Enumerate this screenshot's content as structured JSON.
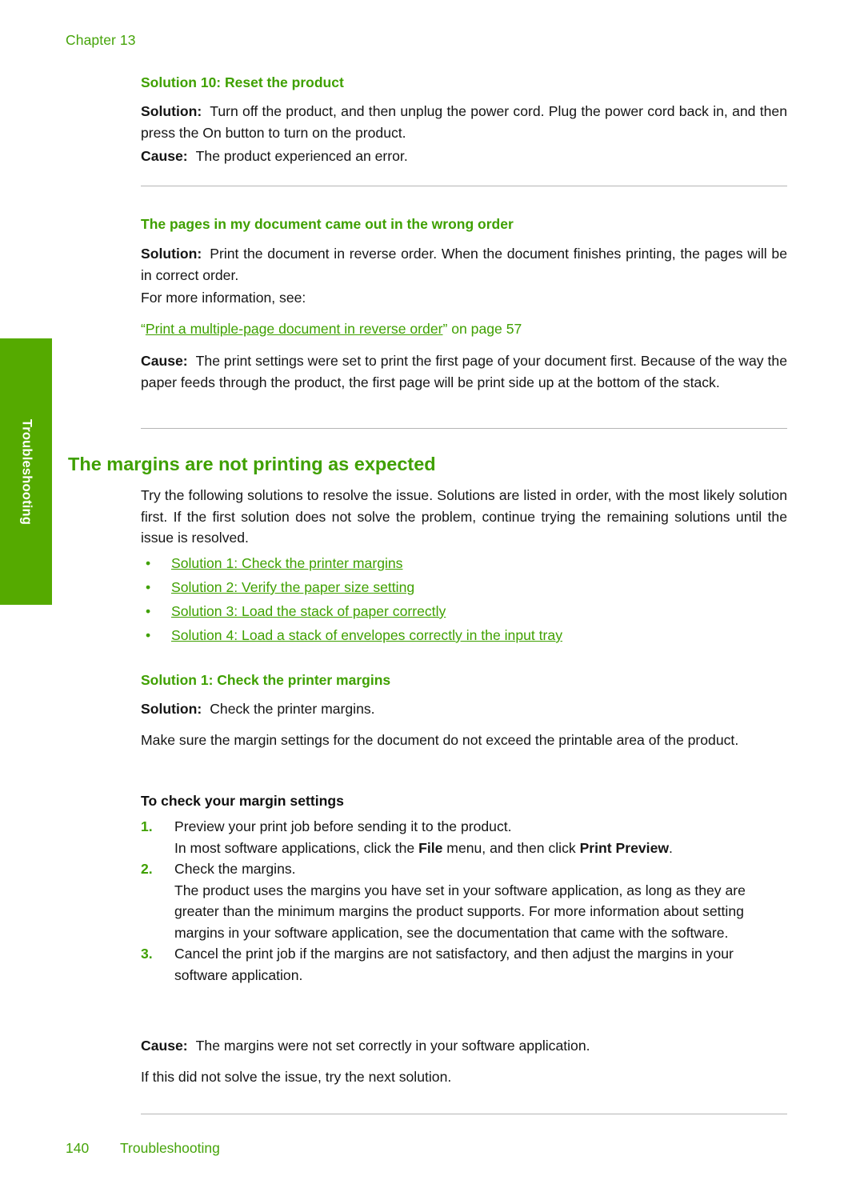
{
  "colors": {
    "heading_green": "#3fa000",
    "tab_green": "#55aa00",
    "header_green": "#46a40a",
    "rule_gray": "#b5b5b5",
    "body_black": "#151515"
  },
  "header": {
    "chapter": "Chapter 13"
  },
  "side_tab": {
    "label": "Troubleshooting"
  },
  "footer": {
    "page_number": "140",
    "section": "Troubleshooting"
  },
  "sections": {
    "solution10": {
      "heading": "Solution 10: Reset the product",
      "solution_label": "Solution:",
      "solution_text": "Turn off the product, and then unplug the power cord. Plug the power cord back in, and then press the On button to turn on the product.",
      "cause_label": "Cause:",
      "cause_text": "The product experienced an error."
    },
    "wrong_order": {
      "heading": "The pages in my document came out in the wrong order",
      "solution_label": "Solution:",
      "solution_text": "Print the document in reverse order. When the document finishes printing, the pages will be in correct order.",
      "more_info": "For more information, see:",
      "xref_open_quote": "“",
      "xref_link": "Print a multiple-page document in reverse order",
      "xref_close": "” on page 57",
      "cause_label": "Cause:",
      "cause_text": "The print settings were set to print the first page of your document first. Because of the way the paper feeds through the product, the first page will be print side up at the bottom of the stack."
    },
    "margins": {
      "heading": "The margins are not printing as expected",
      "intro": "Try the following solutions to resolve the issue. Solutions are listed in order, with the most likely solution first. If the first solution does not solve the problem, continue trying the remaining solutions until the issue is resolved.",
      "bullet_glyph": "•",
      "links": [
        "Solution 1: Check the printer margins",
        "Solution 2: Verify the paper size setting",
        "Solution 3: Load the stack of paper correctly",
        "Solution 4: Load a stack of envelopes correctly in the input tray"
      ]
    },
    "solution1": {
      "heading": "Solution 1: Check the printer margins",
      "solution_label": "Solution:",
      "solution_text": "Check the printer margins.",
      "body_text": "Make sure the margin settings for the document do not exceed the printable area of the product.",
      "procedure_heading": "To check your margin settings",
      "steps": [
        {
          "number": "1.",
          "text": "Preview your print job before sending it to the product.",
          "sub_prefix": "In most software applications, click the ",
          "sub_bold1": "File",
          "sub_mid": " menu, and then click ",
          "sub_bold2": "Print Preview",
          "sub_suffix": "."
        },
        {
          "number": "2.",
          "text": "Check the margins.",
          "sub_prefix": "The product uses the margins you have set in your software application, as long as they are greater than the minimum margins the product supports. For more information about setting margins in your software application, see the documentation that came with the software.",
          "sub_bold1": "",
          "sub_mid": "",
          "sub_bold2": "",
          "sub_suffix": ""
        },
        {
          "number": "3.",
          "text": "Cancel the print job if the margins are not satisfactory, and then adjust the margins in your software application.",
          "sub_prefix": "",
          "sub_bold1": "",
          "sub_mid": "",
          "sub_bold2": "",
          "sub_suffix": ""
        }
      ],
      "cause_label": "Cause:",
      "cause_text": "The margins were not set correctly in your software application.",
      "next_text": "If this did not solve the issue, try the next solution."
    }
  }
}
